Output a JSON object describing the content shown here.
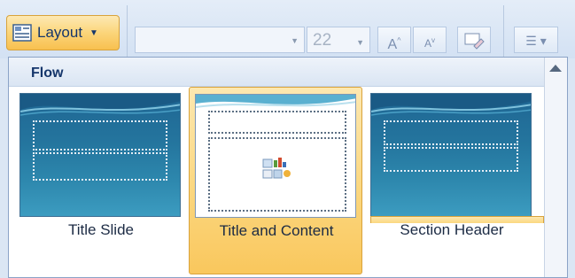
{
  "ribbon": {
    "layout_label": "Layout",
    "layout_icon": "layout-grid-icon",
    "font_size_value": "22",
    "grow_font_icon": "grow-font-icon",
    "shrink_font_icon": "shrink-font-icon",
    "clear_format_icon": "clear-formatting-icon",
    "list_icon": "bullet-list-icon"
  },
  "gallery": {
    "section_title": "Flow",
    "items": [
      {
        "label": "Title Slide",
        "selected": false,
        "style": "blue"
      },
      {
        "label": "Title and Content",
        "selected": true,
        "style": "white"
      },
      {
        "label": "Section Header",
        "selected": false,
        "style": "blue"
      }
    ]
  },
  "colors": {
    "accent": "#fbd57a",
    "header_text": "#15366b",
    "slide_blue": "#24759e"
  }
}
